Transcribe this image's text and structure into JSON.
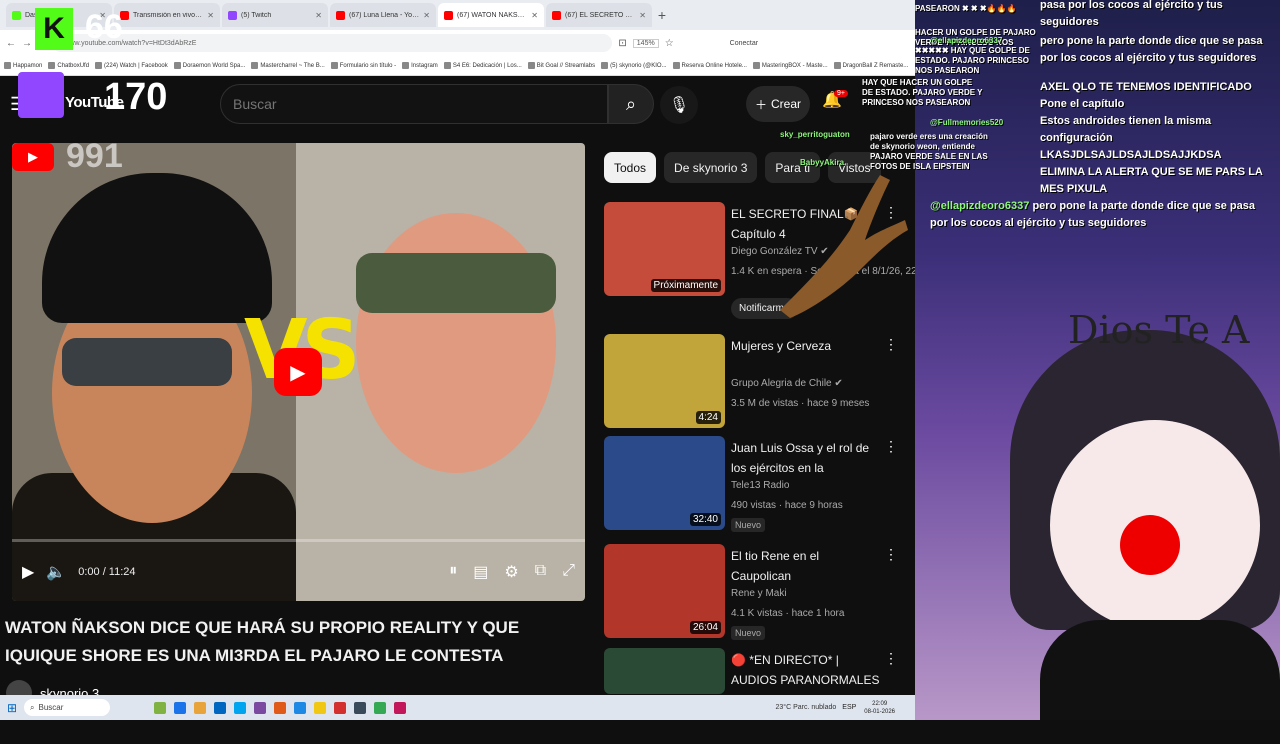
{
  "browser": {
    "tabs": [
      {
        "label": "Dashboard",
        "color": "#53fc18",
        "active": false
      },
      {
        "label": "Transmisión en vivo - YouTube Stu",
        "color": "#ff0000",
        "active": false
      },
      {
        "label": "(5) Twitch",
        "color": "#9146ff",
        "active": false
      },
      {
        "label": "(67) Luna Llena - YouTube",
        "color": "#ff0000",
        "active": false
      },
      {
        "label": "(67) WATON ÑAKSON DICE QUE H",
        "color": "#ff0000",
        "active": true
      },
      {
        "label": "(67) EL SECRETO FINAL📦 Capi",
        "color": "#ff0000",
        "active": false
      }
    ],
    "url": "www.youtube.com/watch?v=HtDt3dAbRzE",
    "zoom": "145%",
    "connect_label": "Conectar",
    "bookmarks": [
      "Happamon",
      "ChatboxUfd",
      "(224) Watch | Facebook",
      "Doraemon World Spa...",
      "Mastercharrel ~ The B...",
      "Formulario sin título -",
      "Instagram",
      "S4 E6: Dedicación | Los...",
      "Bit Goal // Streamlabs",
      "(5) skynorio (@KIO...",
      "Reserva Online Hotele...",
      "MasteringBOX - Maste...",
      "DragonBall Z Remaste..."
    ]
  },
  "overlay": {
    "kick_count": "66",
    "twitch_count": "170",
    "youtube_badge": "991",
    "kick_letter": "K"
  },
  "header": {
    "logo_text": "YouTube",
    "search_placeholder": "Buscar",
    "create_label": "Crear",
    "notif_count": "9+"
  },
  "player": {
    "vs_text": "VS",
    "time": "0:00 / 11:24"
  },
  "video": {
    "title": "WATON ÑAKSON DICE QUE HARÁ SU PROPIO REALITY Y QUE IQUIQUE SHORE ES UNA MI3RDA EL PAJARO LE CONTESTA",
    "channel": "skynorio 3"
  },
  "chips": [
    "Todos",
    "De skynorio 3",
    "Para ti",
    "Vistos"
  ],
  "recommendations": [
    {
      "title": "EL SECRETO FINAL📦 Capítulo 4",
      "channel": "Diego González TV ✔",
      "meta": "1.4 K en espera · Se estrena el 8/1/26, 22:00",
      "badge": "Próximamente",
      "duration": "",
      "extra": "Notificarme"
    },
    {
      "title": "Mujeres y Cerveza",
      "channel": "Grupo Alegria de Chile ✔",
      "meta": "3.5 M de vistas · hace 9 meses",
      "badge": "",
      "duration": "4:24"
    },
    {
      "title": "Juan Luis Ossa y el rol de los ejércitos en la construcción de...",
      "channel": "Tele13 Radio",
      "meta": "490 vistas · hace 9 horas",
      "badge": "Nuevo",
      "duration": "32:40"
    },
    {
      "title": "El tio Rene en el Caupolican",
      "channel": "Rene y Maki",
      "meta": "4.1 K vistas · hace 1 hora",
      "badge": "Nuevo",
      "duration": "26:04"
    },
    {
      "title": "🔴 *EN DIRECTO* | AUDIOS PARANORMALES DE ...",
      "channel": "",
      "meta": "",
      "badge": "",
      "duration": ""
    }
  ],
  "chat_right": [
    {
      "user": "",
      "text": "pasa por los cocos al ejército y tus seguidores"
    },
    {
      "user": "",
      "text": "pero pone la parte donde dice que se pasa por los cocos al ejército y tus seguidores"
    },
    {
      "user": "",
      "text": "AXEL QLO TE TENEMOS IDENTIFICADO"
    },
    {
      "user": "",
      "text": "Pone el capítulo"
    },
    {
      "user": "",
      "text": "Estos androides tienen la misma configuración"
    },
    {
      "user": "",
      "text": "LKASJDLSAJLDSAJLDSAJJKDSA"
    },
    {
      "user": "",
      "text": "ELIMINA LA ALERTA QUE SE ME PARS LA MES PIXULA"
    },
    {
      "user": "@ellapizdeoro6337",
      "text": "pero pone la parte donde dice que se pasa por los cocos al ejército y tus seguidores"
    }
  ],
  "chat_left": [
    {
      "user": "",
      "text": "PASEARON ✖ ✖ ✖🔥🔥🔥"
    },
    {
      "user": "",
      "text": "HACER UN GOLPE DE PAJARO VERDE Y PRINCESO NOS"
    },
    {
      "user": "@ellapizdeoro6337",
      "text": ""
    },
    {
      "user": "",
      "text": "✖✖✖✖✖ HAY QUE GOLPE DE ESTADO. PAJARO PRINCESO NOS PASEARON"
    },
    {
      "user": "",
      "text": "HAY QUE HACER UN GOLPE DE ESTADO. PAJARO VERDE Y PRINCESO NOS PASEARON"
    },
    {
      "user": "sky_perritoguaton",
      "text": ""
    },
    {
      "user": "",
      "text": "pajaro verde eres una creación de skynorio weon, entiende PAJARO VERDE SALE EN LAS FOTOS DE ISLA EIPSTEIN"
    },
    {
      "user": "@Fullmemories520",
      "text": ""
    },
    {
      "user": "BabyyAkira",
      "text": ""
    }
  ],
  "stream_art": {
    "dios_text": "Dios Te A"
  },
  "taskbar": {
    "search_label": "Buscar",
    "weather": "23°C Parc. nublado",
    "lang": "ESP",
    "time": "22:09",
    "date": "08-01-2026"
  }
}
